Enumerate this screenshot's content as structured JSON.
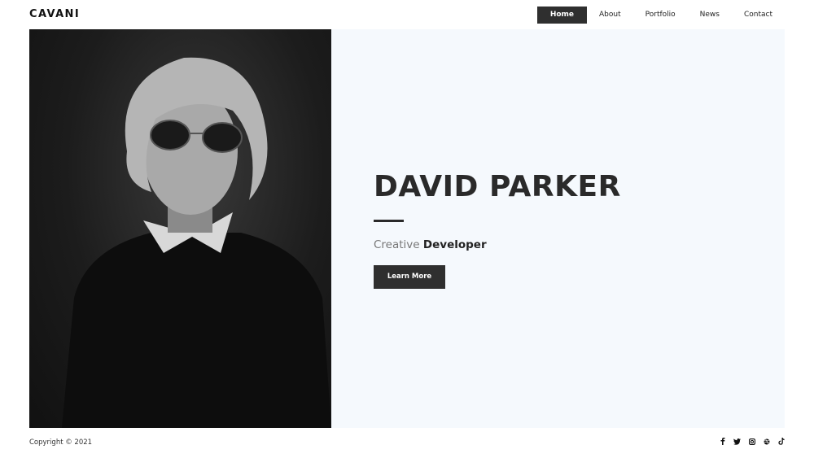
{
  "header": {
    "logo": "CAVANI",
    "nav": [
      {
        "label": "Home",
        "active": true
      },
      {
        "label": "About",
        "active": false
      },
      {
        "label": "Portfolio",
        "active": false
      },
      {
        "label": "News",
        "active": false
      },
      {
        "label": "Contact",
        "active": false
      }
    ]
  },
  "hero": {
    "name": "DAVID PARKER",
    "subtitle_light": "Creative",
    "subtitle_bold": "Developer",
    "cta_label": "Learn More",
    "photo_alt": "portrait-photo"
  },
  "footer": {
    "copyright": "Copyright © 2021",
    "socials": [
      "facebook-icon",
      "twitter-icon",
      "instagram-icon",
      "dribbble-icon",
      "tiktok-icon"
    ]
  },
  "colors": {
    "accent": "#2f2f2f",
    "hero_bg": "#f5f9fd",
    "text": "#2a2a2a"
  }
}
